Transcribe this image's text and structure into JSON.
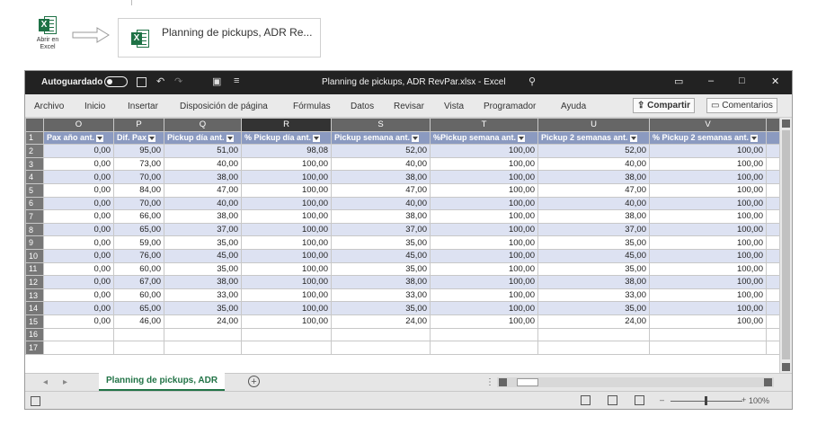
{
  "open_in_excel": {
    "label_line1": "Abrir en",
    "label_line2": "Excel",
    "icon": "excel-icon"
  },
  "file_card": {
    "name": "Planning de pickups, ADR Re...",
    "icon": "excel-icon"
  },
  "titlebar": {
    "autosave_label": "Autoguardado",
    "title": "Planning de pickups, ADR RevPar.xlsx - Excel",
    "icons": [
      "save-icon",
      "undo-icon",
      "redo-icon",
      "clipboard-icon",
      "customize-icon",
      "search-icon",
      "ribbon-display-icon",
      "minimize-icon",
      "maximize-icon",
      "close-icon"
    ]
  },
  "ribbon": {
    "tabs": [
      "Archivo",
      "Inicio",
      "Insertar",
      "Disposición de página",
      "Fórmulas",
      "Datos",
      "Revisar",
      "Vista",
      "Programador",
      "Ayuda"
    ],
    "share_label": "Compartir",
    "comments_label": "Comentarios"
  },
  "sheet": {
    "column_letters": [
      "O",
      "P",
      "Q",
      "R",
      "S",
      "T",
      "U",
      "V"
    ],
    "selected_column": "R",
    "headers": [
      "Pax año ant.",
      "Dif. Pax",
      "Pickup día ant.",
      "% Pickup día ant.",
      "Pickup semana ant.",
      "%Pickup semana ant.",
      "Pickup 2 semanas ant.",
      "% Pickup 2 semanas ant."
    ],
    "rows": [
      {
        "n": "2",
        "cells": [
          "0,00",
          "95,00",
          "51,00",
          "98,08",
          "52,00",
          "100,00",
          "52,00",
          "100,00"
        ]
      },
      {
        "n": "3",
        "cells": [
          "0,00",
          "73,00",
          "40,00",
          "100,00",
          "40,00",
          "100,00",
          "40,00",
          "100,00"
        ]
      },
      {
        "n": "4",
        "cells": [
          "0,00",
          "70,00",
          "38,00",
          "100,00",
          "38,00",
          "100,00",
          "38,00",
          "100,00"
        ]
      },
      {
        "n": "5",
        "cells": [
          "0,00",
          "84,00",
          "47,00",
          "100,00",
          "47,00",
          "100,00",
          "47,00",
          "100,00"
        ]
      },
      {
        "n": "6",
        "cells": [
          "0,00",
          "70,00",
          "40,00",
          "100,00",
          "40,00",
          "100,00",
          "40,00",
          "100,00"
        ]
      },
      {
        "n": "7",
        "cells": [
          "0,00",
          "66,00",
          "38,00",
          "100,00",
          "38,00",
          "100,00",
          "38,00",
          "100,00"
        ]
      },
      {
        "n": "8",
        "cells": [
          "0,00",
          "65,00",
          "37,00",
          "100,00",
          "37,00",
          "100,00",
          "37,00",
          "100,00"
        ]
      },
      {
        "n": "9",
        "cells": [
          "0,00",
          "59,00",
          "35,00",
          "100,00",
          "35,00",
          "100,00",
          "35,00",
          "100,00"
        ]
      },
      {
        "n": "10",
        "cells": [
          "0,00",
          "76,00",
          "45,00",
          "100,00",
          "45,00",
          "100,00",
          "45,00",
          "100,00"
        ]
      },
      {
        "n": "11",
        "cells": [
          "0,00",
          "60,00",
          "35,00",
          "100,00",
          "35,00",
          "100,00",
          "35,00",
          "100,00"
        ]
      },
      {
        "n": "12",
        "cells": [
          "0,00",
          "67,00",
          "38,00",
          "100,00",
          "38,00",
          "100,00",
          "38,00",
          "100,00"
        ]
      },
      {
        "n": "13",
        "cells": [
          "0,00",
          "60,00",
          "33,00",
          "100,00",
          "33,00",
          "100,00",
          "33,00",
          "100,00"
        ]
      },
      {
        "n": "14",
        "cells": [
          "0,00",
          "65,00",
          "35,00",
          "100,00",
          "35,00",
          "100,00",
          "35,00",
          "100,00"
        ]
      },
      {
        "n": "15",
        "cells": [
          "0,00",
          "46,00",
          "24,00",
          "100,00",
          "24,00",
          "100,00",
          "24,00",
          "100,00"
        ]
      },
      {
        "n": "16",
        "cells": [
          "",
          "",
          "",
          "",
          "",
          "",
          "",
          ""
        ]
      },
      {
        "n": "17",
        "cells": [
          "",
          "",
          "",
          "",
          "",
          "",
          "",
          ""
        ]
      }
    ],
    "header_row_number": "1",
    "tab_name": "Planning de pickups, ADR"
  },
  "statusbar": {
    "zoom": "100%"
  },
  "colors": {
    "excel_green": "#217346",
    "header_blue": "#8b9ac0",
    "band_blue": "#dde2f2",
    "titlebar": "#222222"
  }
}
